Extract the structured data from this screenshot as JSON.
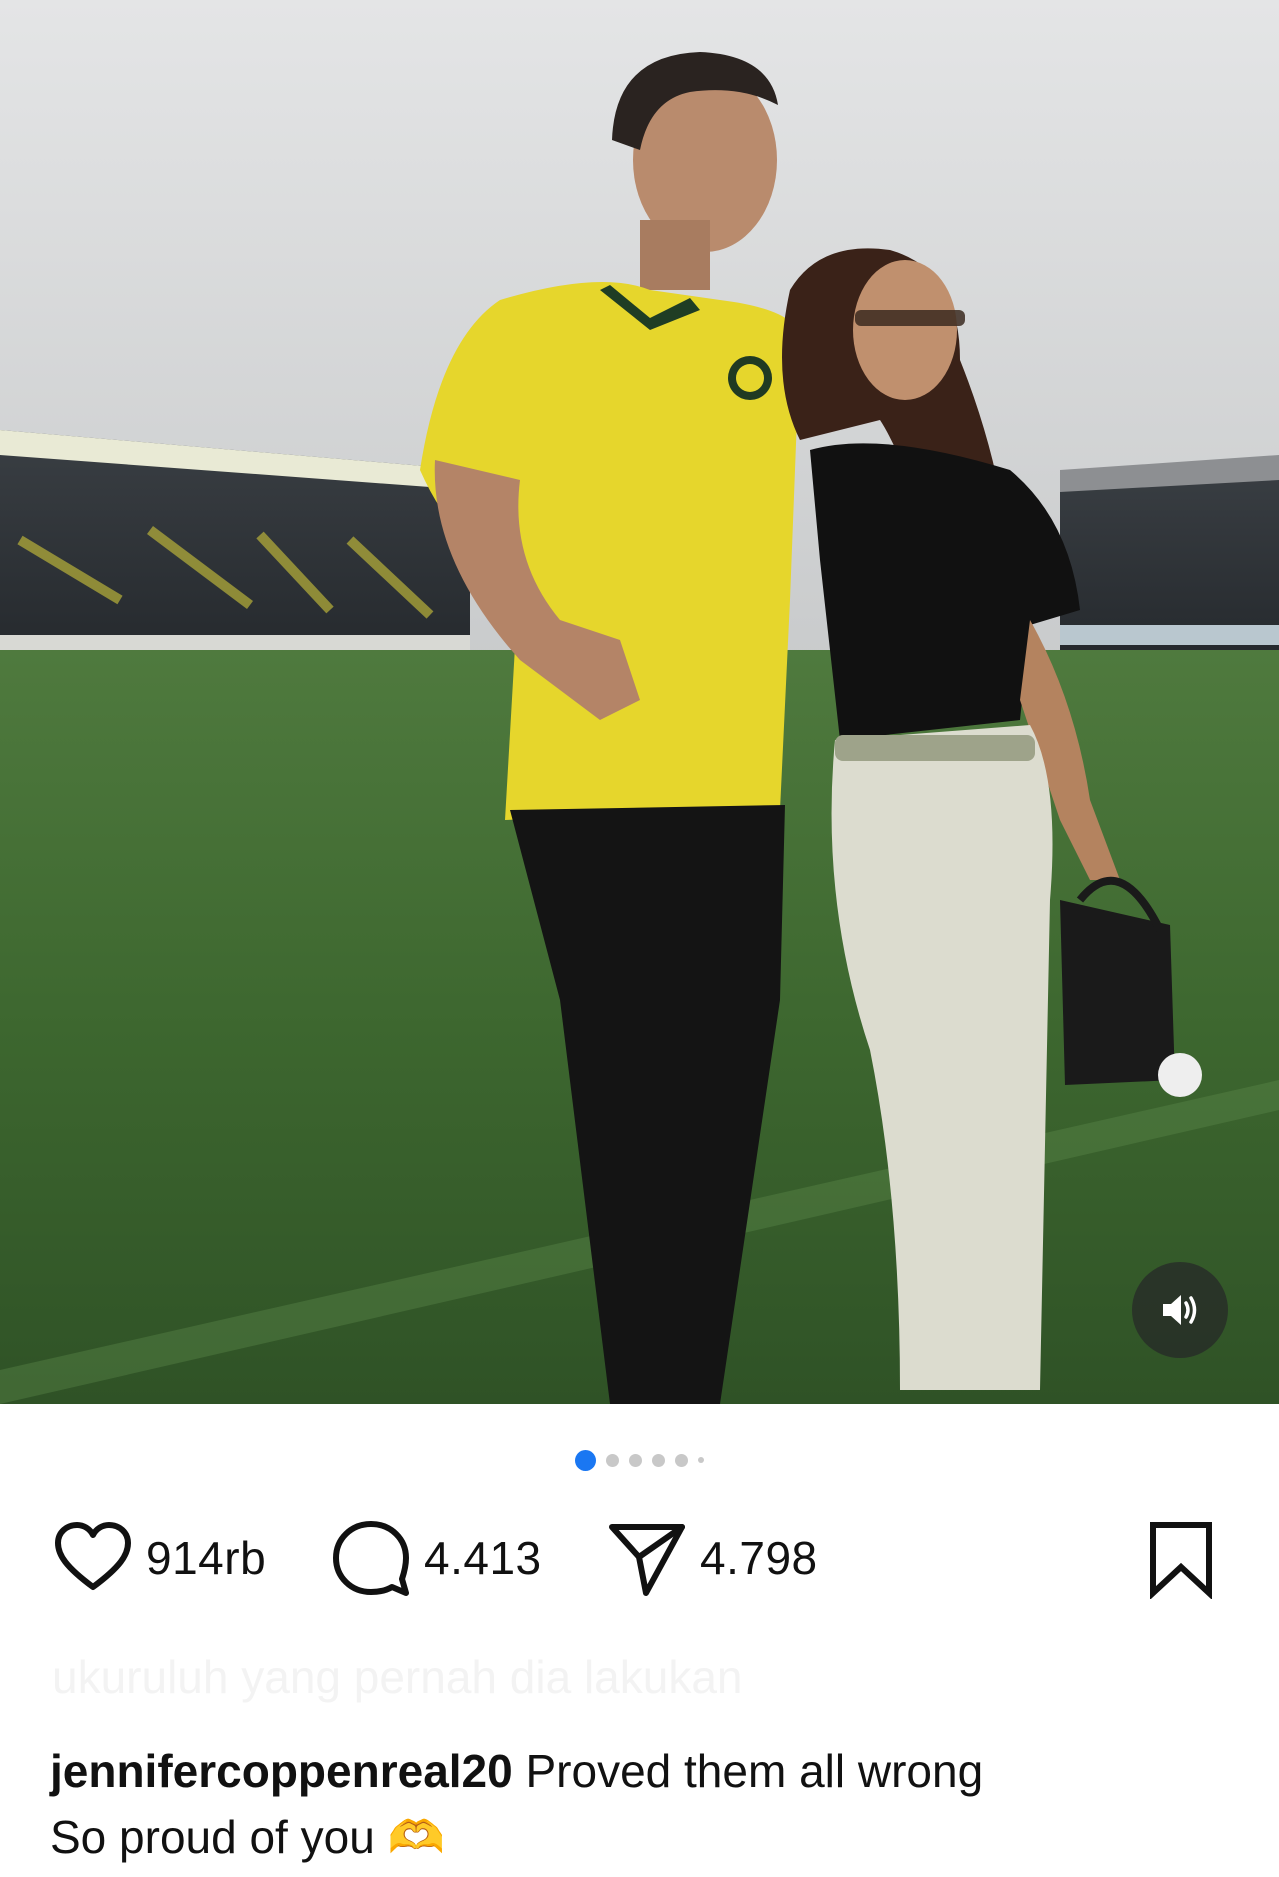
{
  "post": {
    "username": "jennifercoppenreal20",
    "caption_line1": "Proved them all wrong",
    "caption_line2": "So proud of you",
    "caption_emoji": "🫶",
    "faded_comment_preview": "ukuruluh yang pernah dia lakukan"
  },
  "actions": {
    "likes": "914rb",
    "comments": "4.413",
    "shares": "4.798"
  },
  "carousel": {
    "total_dots": 6,
    "active_index": 0
  },
  "media": {
    "sound_toggle_icon": "speaker-on-icon"
  },
  "icons": {
    "like": "heart-icon",
    "comment": "comment-bubble-icon",
    "share": "paper-plane-icon",
    "save": "bookmark-icon"
  },
  "colors": {
    "active_dot": "#1a77f2",
    "inactive_dot": "#c8c8c8",
    "jersey": "#e6d62c",
    "pitch": "#3f6a35"
  }
}
